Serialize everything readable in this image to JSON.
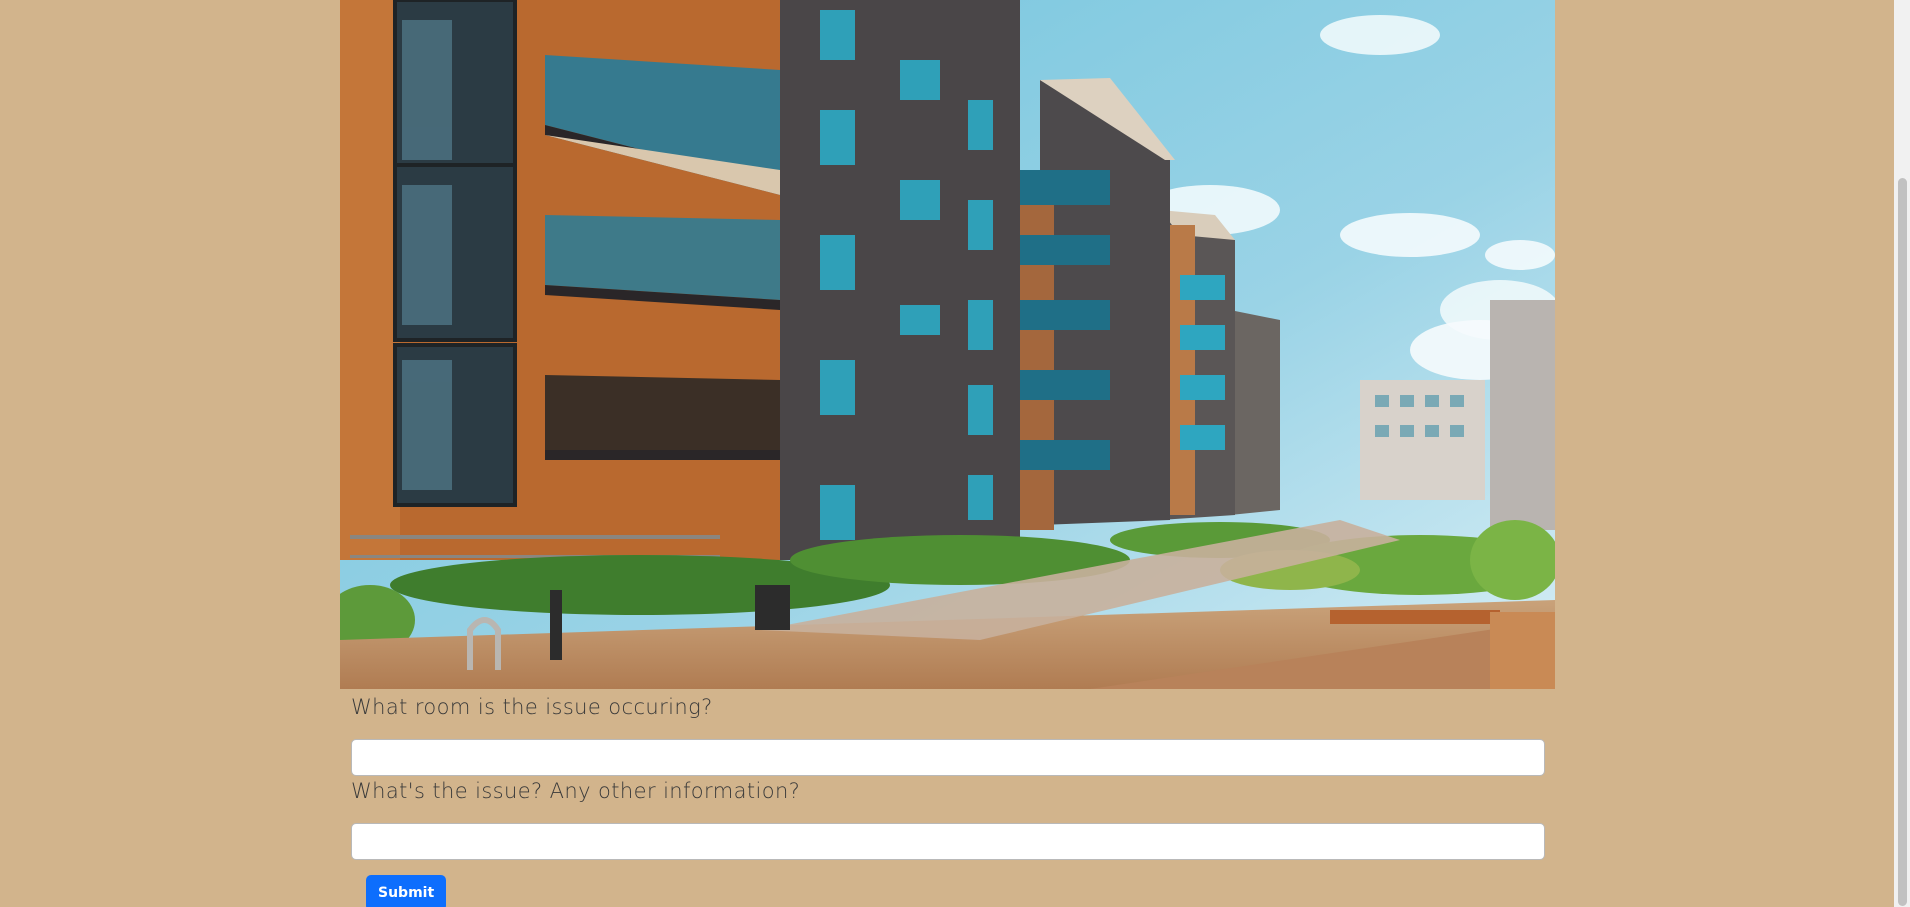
{
  "hero": {
    "image_description_icon": "apartment-building-photo"
  },
  "form": {
    "room_label": "What room is the issue occuring?",
    "room_value": "",
    "room_placeholder": "",
    "issue_label": "What's the issue? Any other information?",
    "issue_value": "",
    "issue_placeholder": "",
    "submit_label": "Submit"
  },
  "colors": {
    "background": "#d2b48c",
    "submit": "#0d6efd"
  }
}
